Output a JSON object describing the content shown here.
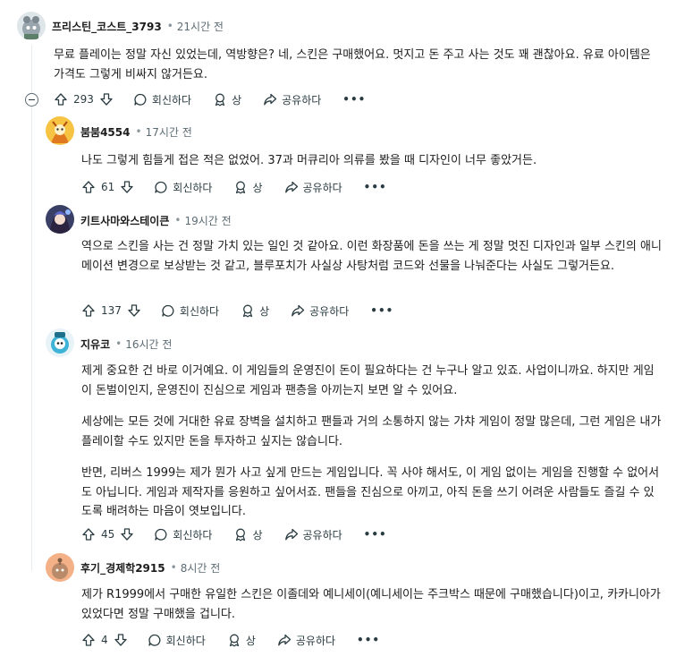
{
  "comments": [
    {
      "author": "프리스틴_코스트_3793",
      "time": "21시간 전",
      "paragraphs": [
        "무료 플레이는 정말 자신 있었는데, 역방향은? 네, 스킨은 구매했어요. 멋지고 돈 주고 사는 것도 꽤 괜찮아요. 유료 아이템은 가격도 그렇게 비싸지 않거든요."
      ],
      "votes": "293"
    },
    {
      "author": "붐붐4554",
      "time": "17시간 전",
      "paragraphs": [
        "나도 그렇게 힘들게 접은 적은 없었어. 37과 머큐리아 의류를 봤을 때 디자인이 너무 좋았거든."
      ],
      "votes": "61"
    },
    {
      "author": "키트사마와스테이큰",
      "time": "19시간 전",
      "paragraphs": [
        "역으로 스킨을 사는 건 정말 가치 있는 일인 것 같아요. 이런 화장품에 돈을 쓰는 게 정말 멋진 디자인과 일부 스킨의 애니메이션 변경으로 보상받는 것 같고, 블루포치가 사실상 사탕처럼 코드와 선물을 나눠준다는 사실도 그렇거든요."
      ],
      "votes": "137"
    },
    {
      "author": "지유코",
      "time": "16시간 전",
      "paragraphs": [
        "제게 중요한 건 바로 이거예요. 이 게임들의 운영진이 돈이 필요하다는 건 누구나 알고 있죠. 사업이니까요. 하지만 게임이 돈벌이인지, 운영진이 진심으로 게임과 팬층을 아끼는지 보면 알 수 있어요.",
        "세상에는 모든 것에 거대한 유료 장벽을 설치하고 팬들과 거의 소통하지 않는 가챠 게임이 정말 많은데, 그런 게임은 내가 플레이할 수도 있지만 돈을 투자하고 싶지는 않습니다.",
        "반면, 리버스 1999는 제가 뭔가 사고 싶게 만드는 게임입니다. 꼭 사야 해서도, 이 게임 없이는 게임을 진행할 수 없어서도 아닙니다. 게임과 제작자를 응원하고 싶어서죠. 팬들을 진심으로 아끼고, 아직 돈을 쓰기 어려운 사람들도 즐길 수 있도록 배려하는 마음이 엿보입니다."
      ],
      "votes": "45"
    },
    {
      "author": "후기_경제학2915",
      "time": "8시간 전",
      "paragraphs": [
        "제가 R1999에서 구매한 유일한 스킨은 이졸데와 예니세이(예니세이는 주크박스 때문에 구매했습니다)이고, 카카니아가 있었다면 정말 구매했을 겁니다."
      ],
      "votes": "4"
    }
  ],
  "actions": {
    "reply_label": "회신하다",
    "award_label": "상",
    "share_label": "공유하다",
    "more_label": "•••"
  },
  "colors": {
    "thread_line": "#e5ebee",
    "text": "#1c1c1c",
    "meta": "#5c6c74"
  }
}
